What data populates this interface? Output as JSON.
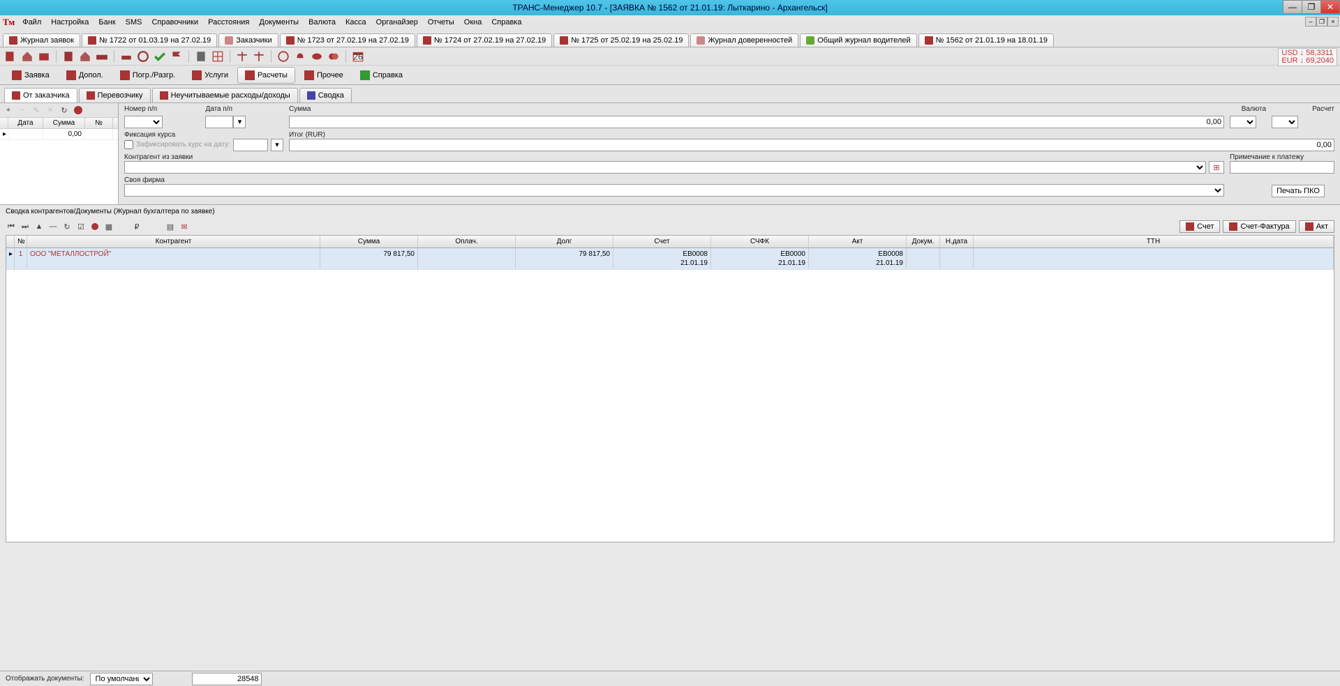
{
  "title": "ТРАНС-Менеджер 10.7 - [ЗАЯВКА № 1562 от 21.01.19: Лыткарино - Архангельск]",
  "menu": [
    "Файл",
    "Настройка",
    "Банк",
    "SMS",
    "Справочники",
    "Расстояния",
    "Документы",
    "Валюта",
    "Касса",
    "Органайзер",
    "Отчеты",
    "Окна",
    "Справка"
  ],
  "currency": {
    "usd_label": "USD ↓ 58,3311",
    "eur_label": "EUR ↓ 69,2040"
  },
  "doctabs": [
    {
      "label": "Журнал заявок"
    },
    {
      "label": "№ 1722 от 01.03.19 на 27.02.19"
    },
    {
      "label": "Заказчики"
    },
    {
      "label": "№ 1723 от 27.02.19 на 27.02.19"
    },
    {
      "label": "№ 1724 от 27.02.19 на 27.02.19"
    },
    {
      "label": "№ 1725 от 25.02.19 на 25.02.19"
    },
    {
      "label": "Журнал доверенностей"
    },
    {
      "label": "Общий журнал водителей"
    },
    {
      "label": "№ 1562 от 21.01.19 на 18.01.19"
    }
  ],
  "maintabs": [
    {
      "label": "Заявка"
    },
    {
      "label": "Допол."
    },
    {
      "label": "Погр./Разгр."
    },
    {
      "label": "Услуги"
    },
    {
      "label": "Расчеты"
    },
    {
      "label": "Прочее"
    },
    {
      "label": "Справка"
    }
  ],
  "subtabs": [
    {
      "label": "От заказчика"
    },
    {
      "label": "Перевозчику"
    },
    {
      "label": "Неучитываемые расходы/доходы"
    },
    {
      "label": "Сводка"
    }
  ],
  "leftgrid": {
    "headers": [
      "Дата",
      "Сумма",
      "№"
    ],
    "row": {
      "date": "",
      "sum": "0,00",
      "no": ""
    }
  },
  "form": {
    "nomer_label": "Номер п/п",
    "data_label": "Дата п/п",
    "summa_label": "Сумма",
    "valuta_label": "Валюта",
    "raschet_label": "Расчет",
    "summa_value": "0,00",
    "fix_label": "Фиксация курса",
    "fix_check": "Зафиксировать курс на дату:",
    "itog_label": "Итог (RUR)",
    "itog_value": "0,00",
    "kontr_label": "Контрагент из заявки",
    "prim_label": "Примечание к платежу",
    "firma_label": "Своя фирма",
    "print_btn": "Печать ПКО"
  },
  "summary_label": "Сводка контрагентов/Документы (Журнал бухгалтера по заявке)",
  "doc_buttons": {
    "schet": "Счет",
    "sf": "Счет-Фактура",
    "akt": "Акт"
  },
  "grid": {
    "headers": [
      "№",
      "Контрагент",
      "Сумма",
      "Оплач.",
      "Долг",
      "Счет",
      "СЧФК",
      "Акт",
      "Докум.",
      "Н.дата",
      "ТТН"
    ],
    "row": {
      "no": "1",
      "kontragent": "ООО \"МЕТАЛЛОСТРОЙ\"",
      "summa": "79 817,50",
      "oplach": "",
      "dolg": "79 817,50",
      "schet": "ЕВ0008\n21.01.19",
      "schfk": "ЕВ0000\n21.01.19",
      "akt": "ЕВ0008\n21.01.19",
      "dokum": "",
      "ndata": "",
      "ttn": ""
    }
  },
  "bottom": {
    "display_label": "Отображать документы:",
    "mode": "По умолчанию",
    "count": "28548"
  }
}
